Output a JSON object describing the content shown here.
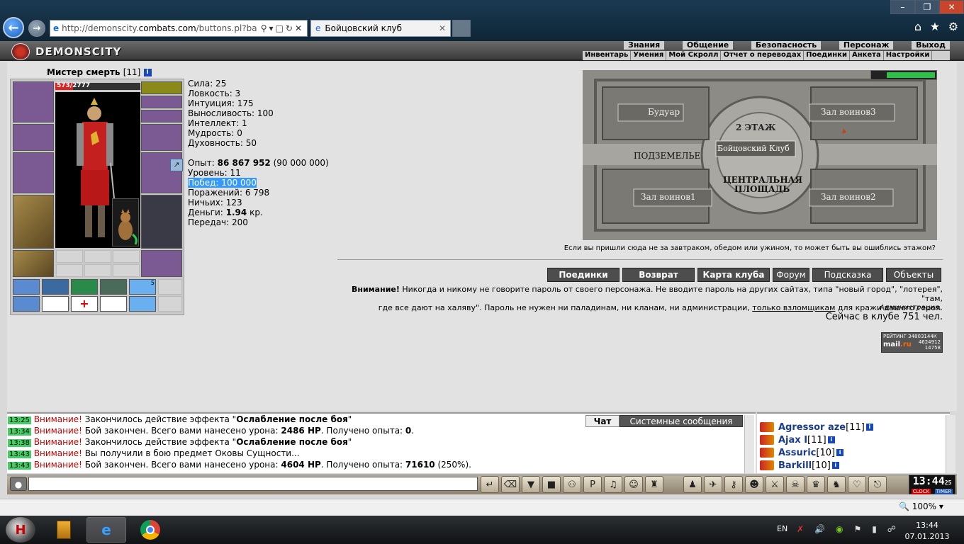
{
  "browser": {
    "url_prefix": "http://demonscity.",
    "url_host": "combats.com",
    "url_suffix": "/buttons.pl?ba",
    "tab_title": "Бойцовский клуб",
    "zoom": "100%"
  },
  "header": {
    "logo_text": "DEMONSCITY",
    "menu_top": [
      "Знания",
      "Общение",
      "Безопасность",
      "Персонаж",
      "Выход"
    ],
    "menu_bottom": [
      "Инвентарь",
      "Умения",
      "Мой Скролл",
      "Отчет о переводах",
      "Поединки",
      "Анкета",
      "Настройки"
    ]
  },
  "character": {
    "name": "Мистер смерть",
    "level": "[11]",
    "hp_text": "573/2777",
    "hp_fraction": 0.206,
    "scroll_count": "5",
    "stats": {
      "strength": "Сила: 25",
      "agility": "Ловкость: 3",
      "intuition": "Интуиция: 175",
      "endurance": "Выносливость: 100",
      "intellect": "Интеллект: 1",
      "wisdom": "Мудрость: 0",
      "spirit": "Духовность: 50"
    },
    "exp_label": "Опыт: ",
    "exp_value": "86 867 952",
    "exp_next": " (90 000 000)",
    "level_line": "Уровень: 11",
    "wins": "Побед: 100 000",
    "losses": "Поражений: 6 798",
    "draws": "Ничьих: 123",
    "money_label": "Деньги: ",
    "money_value": "1.94",
    "money_unit": " кр.",
    "transfers": "Передач: 200"
  },
  "map": {
    "room_budoir": "Будуар",
    "room_warriors3": "Зал воинов3",
    "floor2": "2 ЭТАЖ",
    "club": "Бойцовский Клуб",
    "dungeon": "ПОДЗЕМЕЛЬЕ",
    "central1": "ЦЕНТРАЛЬНАЯ",
    "central2": "ПЛОЩАДЬ",
    "room_warriors1": "Зал воинов1",
    "room_warriors2": "Зал воинов2",
    "caption": "Если вы пришли сюда не за завтраком, обедом или ужином, то может быть вы ошиблись этажом?"
  },
  "actions": {
    "duels": "Поединки",
    "return": "Возврат",
    "club_map": "Карта клуба",
    "forum": "Форум",
    "hint": "Подсказка",
    "objects": "Объекты"
  },
  "notice": {
    "label": "Внимание!",
    "text1": " Никогда и никому не говорите пароль от своего персонажа. Не вводите пароль на других сайтах, типа \"новый город\", \"лотерея\", \"там,",
    "text2": "где все дают на халяву\". Пароль не нужен ни паладинам, ни кланам, ни администрации, ",
    "link": "только взломщикам",
    "text3": " для кражи вашего героя.",
    "admin": "Администрация.",
    "online": "Сейчас в клубе 751 чел."
  },
  "rating": {
    "line1": "РЕЙТИНГ 34803144К",
    "mail_a": "mail",
    "mail_b": ".ru",
    "n1": "4624912",
    "n2": "14758"
  },
  "chat": {
    "tab_chat": "Чат",
    "tab_system": "Системные сообщения",
    "lines": [
      {
        "time": "13:25",
        "warn": "Внимание!",
        "text": " Закончилось действие эффекта \"",
        "bold": "Ослабление после боя",
        "tail": "\""
      },
      {
        "time": "13:34",
        "warn": "Внимание!",
        "text": " Бой закончен. Всего вами нанесено урона: ",
        "bold": "2486 HP",
        "tail": ". Получено опыта: ",
        "bold2": "0",
        "tail2": "."
      },
      {
        "time": "13:38",
        "warn": "Внимание!",
        "text": " Закончилось действие эффекта \"",
        "bold": "Ослабление после боя",
        "tail": "\""
      },
      {
        "time": "13:43",
        "warn": "Внимание!",
        "text": " Вы получили в бою предмет Оковы Сущности...",
        "bold": "",
        "tail": ""
      },
      {
        "time": "13:43",
        "warn": "Внимание!",
        "text": " Бой закончен. Всего вами нанесено урона: ",
        "bold": "4604 HP",
        "tail": ". Получено опыта: ",
        "bold2": "71610",
        "tail2": " (250%)."
      }
    ]
  },
  "online_list": {
    "users": [
      {
        "name": "Agressor aze",
        "level": "[11]"
      },
      {
        "name": "Ajax I",
        "level": "[11]"
      },
      {
        "name": "Assuric",
        "level": "[10]"
      },
      {
        "name": "Barkill",
        "level": "[10]"
      }
    ]
  },
  "clock": {
    "time": "13:44",
    "seconds": "25",
    "clock_label": "CLOCK",
    "timer_label": "TIMER"
  },
  "taskbar": {
    "lang": "EN",
    "time": "13:44",
    "date": "07.01.2013"
  }
}
